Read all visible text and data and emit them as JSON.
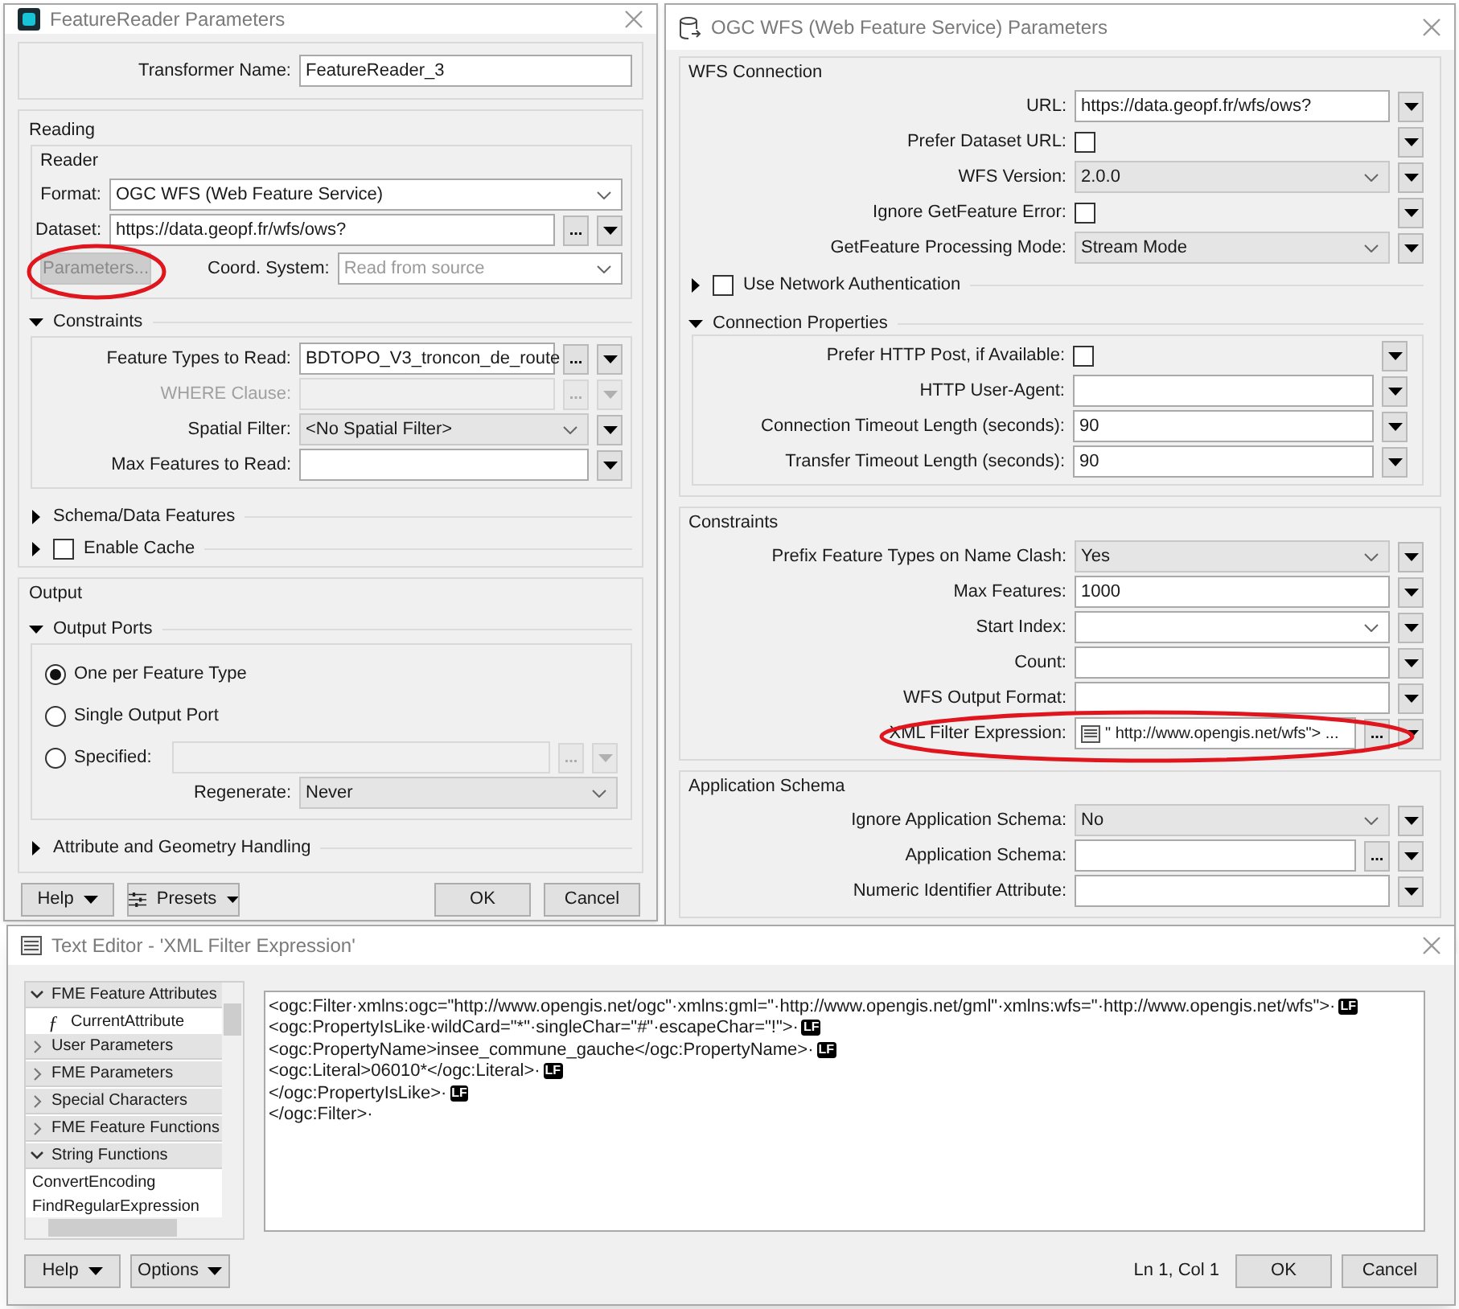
{
  "reader_window": {
    "title": "FeatureReader Parameters",
    "transformer_name": {
      "kind": "text",
      "label": "Transformer Name:",
      "value": "FeatureReader_3"
    },
    "reading": {
      "title": "Reading",
      "reader": {
        "title": "Reader",
        "rows": [
          {
            "kind": "combo",
            "label": "Format:",
            "value": "OGC WFS (Web Feature Service)"
          },
          {
            "kind": "text",
            "label": "Dataset:",
            "value": "https://data.geopf.fr/wfs/ows?",
            "browse": "...",
            "menu": true
          }
        ],
        "parameters_button": {
          "label": "Parameters...",
          "disabled": true
        },
        "coord_system": {
          "kind": "combo",
          "label": "Coord. System:",
          "placeholder": "Read from source"
        }
      },
      "constraints": {
        "title": "Constraints",
        "expanded": true,
        "rows": [
          {
            "kind": "text",
            "label": "Feature Types to Read:",
            "value": "BDTOPO_V3_troncon_de_route",
            "browse": "...",
            "menu": true,
            "disabled": false
          },
          {
            "kind": "text",
            "label": "WHERE Clause:",
            "browse": "...",
            "menu": true,
            "disabled": true
          },
          {
            "kind": "select",
            "label": "Spatial Filter:",
            "value": "<No Spatial Filter>",
            "menu": true,
            "disabled": false
          },
          {
            "kind": "text",
            "label": "Max Features to Read:",
            "menu": true,
            "disabled": false
          }
        ]
      },
      "sections": [
        {
          "title": "Schema/Data Features",
          "expanded": false
        },
        {
          "title": "Enable Cache",
          "expanded": false,
          "checked": false
        }
      ]
    },
    "output": {
      "title": "Output",
      "output_ports": {
        "title": "Output Ports",
        "expanded": true,
        "options": [
          {
            "label": "One per Feature Type",
            "selected": true
          },
          {
            "label": "Single Output Port",
            "selected": false
          },
          {
            "label": "Specified:",
            "selected": false
          }
        ],
        "specified_field": {
          "browse": "...",
          "menu": true,
          "disabled": true
        },
        "regenerate": {
          "kind": "select",
          "label": "Regenerate:",
          "value": "Never"
        }
      },
      "sections": [
        {
          "title": "Attribute and Geometry Handling",
          "expanded": false
        }
      ]
    },
    "left_buttons": [
      {
        "kind": "dropdown",
        "label": "Help"
      },
      {
        "kind": "presets",
        "label": "Presets"
      }
    ],
    "right_buttons": [
      {
        "label": "OK"
      },
      {
        "label": "Cancel"
      }
    ]
  },
  "wfs_window": {
    "title": "OGC WFS (Web Feature Service) Parameters",
    "connection": {
      "title": "WFS Connection",
      "rows": [
        {
          "kind": "text",
          "label": "URL:",
          "value": "https://data.geopf.fr/wfs/ows?",
          "menu": true
        },
        {
          "kind": "checkbox",
          "label": "Prefer Dataset URL:",
          "checked": false,
          "menu": true
        },
        {
          "kind": "select",
          "label": "WFS Version:",
          "value": "2.0.0",
          "menu": true
        },
        {
          "kind": "checkbox",
          "label": "Ignore GetFeature Error:",
          "checked": false,
          "menu": true
        },
        {
          "kind": "select",
          "label": "GetFeature Processing Mode:",
          "value": "Stream Mode",
          "menu": true
        }
      ],
      "network_authentication": {
        "title": "Use Network Authentication",
        "expanded": false,
        "checked": false
      },
      "connection_properties": {
        "title": "Connection Properties",
        "expanded": true,
        "rows": [
          {
            "kind": "checkbox",
            "label": "Prefer HTTP Post, if Available:",
            "checked": false,
            "menu": true
          },
          {
            "kind": "text",
            "label": "HTTP User-Agent:",
            "menu": true
          },
          {
            "kind": "text",
            "label": "Connection Timeout Length (seconds):",
            "value": "90",
            "menu": true
          },
          {
            "kind": "text",
            "label": "Transfer Timeout Length (seconds):",
            "value": "90",
            "menu": true
          }
        ]
      }
    },
    "constraints": {
      "title": "Constraints",
      "rows": [
        {
          "kind": "select",
          "label": "Prefix Feature Types on Name Clash:",
          "value": "Yes",
          "menu": true
        },
        {
          "kind": "text",
          "label": "Max Features:",
          "value": "1000",
          "menu": true
        },
        {
          "kind": "combo",
          "label": "Start Index:",
          "menu": true
        },
        {
          "kind": "text",
          "label": "Count:",
          "menu": true
        },
        {
          "kind": "text",
          "label": "WFS Output Format:",
          "menu": true
        },
        {
          "kind": "expression",
          "label": "XML Filter Expression:",
          "value": "\" http://www.opengis.net/wfs\">  ...",
          "browse": "...",
          "menu": true
        }
      ]
    },
    "application_schema": {
      "title": "Application Schema",
      "rows": [
        {
          "kind": "select",
          "label": "Ignore Application Schema:",
          "value": "No",
          "menu": true
        },
        {
          "kind": "text",
          "label": "Application Schema:",
          "browse": "...",
          "menu": true
        },
        {
          "kind": "text",
          "label": "Numeric Identifier Attribute:",
          "menu": true
        }
      ]
    }
  },
  "editor_window": {
    "title": "Text Editor - 'XML Filter Expression'",
    "tree": [
      {
        "label": "FME Feature Attributes",
        "expanded": true,
        "children": [
          {
            "label": "CurrentAttribute",
            "symbol": "ƒ"
          }
        ]
      },
      {
        "label": "User Parameters",
        "expanded": false
      },
      {
        "label": "FME Parameters",
        "expanded": false
      },
      {
        "label": "Special Characters",
        "expanded": false
      },
      {
        "label": "FME Feature Functions",
        "expanded": false
      },
      {
        "label": "String Functions",
        "expanded": true,
        "children": [
          {
            "label": "ConvertEncoding"
          },
          {
            "label": "FindRegularExpression"
          }
        ]
      }
    ],
    "lines": [
      {
        "text": "<ogc:Filter·xmlns:ogc=\"http://www.opengis.net/ogc\"·xmlns:gml=\"·http://www.opengis.net/gml\"·xmlns:wfs=\"·http://www.opengis.net/wfs\">·",
        "end_marker": "LF"
      },
      {
        "text": "<ogc:PropertyIsLike·wildCard=\"*\"·singleChar=\"#\"·escapeChar=\"!\">·",
        "end_marker": "LF"
      },
      {
        "text": "<ogc:PropertyName>insee_commune_gauche</ogc:PropertyName>·",
        "end_marker": "LF"
      },
      {
        "text": "<ogc:Literal>06010*</ogc:Literal>·",
        "end_marker": "LF"
      },
      {
        "text": "</ogc:PropertyIsLike>·",
        "end_marker": "LF"
      },
      {
        "text": "</ogc:Filter>·"
      }
    ],
    "status": "Ln 1, Col 1",
    "left_buttons": [
      {
        "kind": "dropdown",
        "label": "Help"
      },
      {
        "kind": "dropdown",
        "label": "Options"
      }
    ],
    "right_buttons": [
      {
        "label": "OK"
      },
      {
        "label": "Cancel"
      }
    ]
  }
}
